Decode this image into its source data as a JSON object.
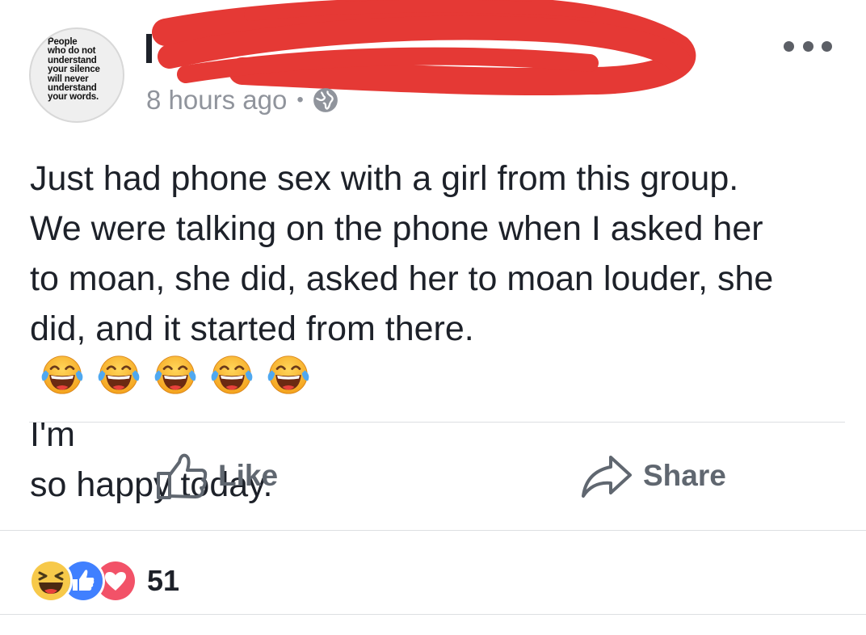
{
  "post": {
    "avatar": {
      "text_lines": [
        "People",
        "who do not",
        "understand",
        "your silence",
        "will never",
        "understand",
        "your words."
      ]
    },
    "author": {
      "name_visible": "[redacted]"
    },
    "timestamp": "8 hours ago",
    "visibility_icon": "globe-icon",
    "more_icon": "ellipsis-icon",
    "body": {
      "line1": "Just had phone sex with a girl from this group.",
      "line2": "We were talking on the phone when I asked her",
      "line3": "to moan, she did, asked her to moan louder, she",
      "line4_before": "did, and it started from there.",
      "emojis": [
        "face-with-tears-of-joy",
        "face-with-tears-of-joy",
        "face-with-tears-of-joy",
        "face-with-tears-of-joy",
        "face-with-tears-of-joy"
      ],
      "line4_after": "I'm",
      "line5": "so happy today."
    }
  },
  "actions": {
    "like_label": "Like",
    "share_label": "Share"
  },
  "reactions": {
    "types": [
      "haha",
      "like",
      "love"
    ],
    "count": "51"
  },
  "colors": {
    "text": "#1d2129",
    "meta": "#90949c",
    "action": "#606770",
    "redaction": "#e53935",
    "like_blue": "#4080ff",
    "love_red": "#f25268",
    "haha_yellow": "#f7c94a"
  }
}
